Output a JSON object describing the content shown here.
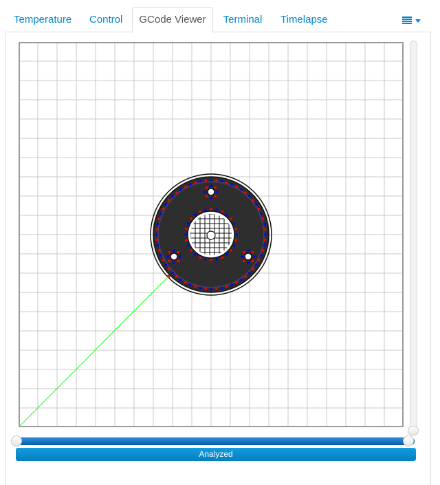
{
  "tabs": [
    {
      "label": "Temperature",
      "active": false
    },
    {
      "label": "Control",
      "active": false
    },
    {
      "label": "GCode Viewer",
      "active": true
    },
    {
      "label": "Terminal",
      "active": false
    },
    {
      "label": "Timelapse",
      "active": false
    }
  ],
  "menu_icon": "list-icon",
  "viewer": {
    "grid_color": "#c8c8c8",
    "border_color": "#9a9a9a",
    "travel_color": "#33ff33",
    "model_color": "#111111",
    "retract_color": "#ff0000",
    "restart_color": "#0000ff"
  },
  "layer_slider": {
    "value": 1.0
  },
  "range_slider": {
    "min": 0.0,
    "max": 1.0
  },
  "progress": {
    "label": "Analyzed",
    "percent": 100,
    "color": "#149bdf"
  }
}
